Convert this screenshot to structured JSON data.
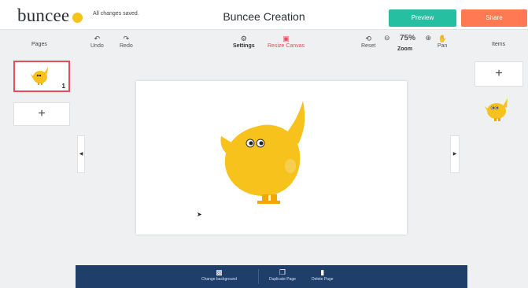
{
  "header": {
    "logo": "buncee",
    "save_status": "All changes saved.",
    "title": "Buncee Creation",
    "preview_label": "Preview",
    "share_label": "Share"
  },
  "toolbar": {
    "undo_label": "Undo",
    "redo_label": "Redo",
    "settings_label": "Settings",
    "resize_label": "Resize Canvas",
    "reset_label": "Reset",
    "zoom_value": "75%",
    "zoom_label": "Zoom",
    "pan_label": "Pan"
  },
  "left_sidebar": {
    "title": "Pages",
    "pages": [
      {
        "number": "1"
      }
    ],
    "add_label": "+"
  },
  "right_sidebar": {
    "title": "Items",
    "add_label": "+"
  },
  "bottom_bar": {
    "change_background_label": "Change background",
    "duplicate_label": "Duplicate Page",
    "delete_label": "Delete Page"
  },
  "colors": {
    "brand_yellow": "#f8c21c",
    "accent_red": "#e84b5b",
    "preview_teal": "#26bfa2",
    "share_orange": "#ff7a52",
    "bottom_bar_navy": "#1f3f6a"
  },
  "icons": {
    "undo": "undo-icon",
    "redo": "redo-icon",
    "settings": "gear-icon",
    "resize": "resize-icon",
    "reset": "reset-icon",
    "zoom_out": "zoom-out-icon",
    "zoom_in": "zoom-in-icon",
    "pan": "hand-icon",
    "background": "image-icon",
    "duplicate": "copy-icon",
    "delete": "trash-icon"
  }
}
